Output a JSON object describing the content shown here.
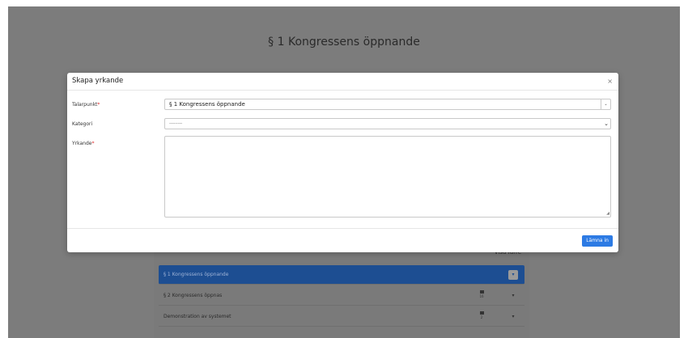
{
  "background": {
    "title": "§ 1 Kongressens öppnande",
    "visa_farre": "Visa färre",
    "agenda": [
      {
        "label": "§ 1 Kongressens öppnande",
        "active": true,
        "count": ""
      },
      {
        "label": "§ 2 Kongressens öppnas",
        "active": false,
        "count": "16"
      },
      {
        "label": "Demonstration av systemet",
        "active": false,
        "count": "2"
      }
    ]
  },
  "modal": {
    "title": "Skapa yrkande",
    "close_symbol": "×",
    "fields": {
      "talarpunkt_label": "Talarpunkt",
      "talarpunkt_value": "§ 1 Kongressens öppnande",
      "kategori_label": "Kategori",
      "kategori_value": "---------",
      "yrkande_label": "Yrkande",
      "required_marker": "*"
    },
    "submit_label": "Lämna in"
  },
  "colors": {
    "overlay": "#7c7c7c",
    "active_item": "#1d4e92",
    "primary_button": "#2d7be4",
    "required": "#dd2222"
  }
}
